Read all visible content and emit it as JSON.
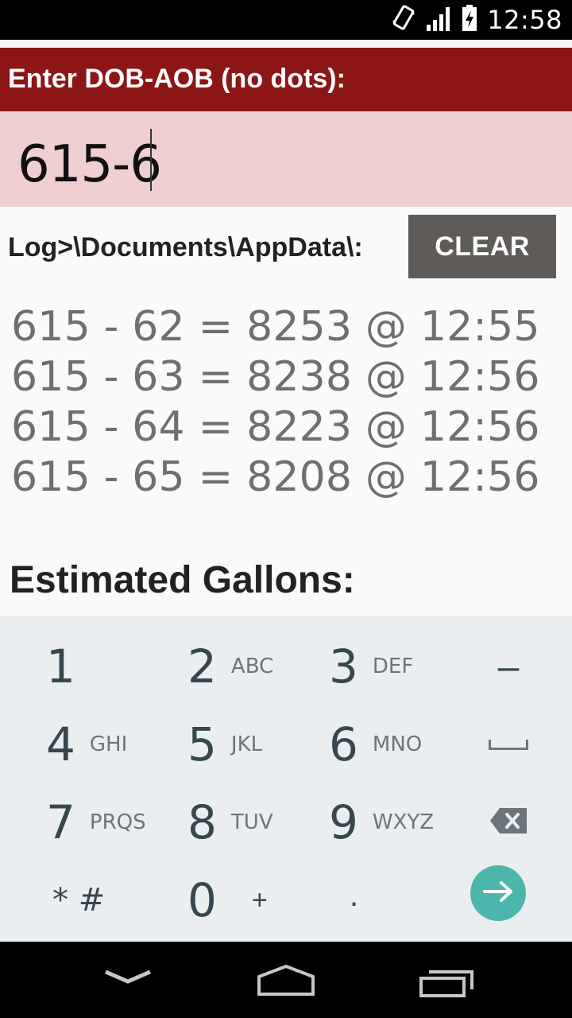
{
  "status_bar": {
    "time": "12:58",
    "icons": [
      "vibrate-icon",
      "signal-icon",
      "battery-charging-icon"
    ]
  },
  "header": {
    "title": "Enter DOB-AOB (no dots):"
  },
  "input": {
    "value": "615-6"
  },
  "log": {
    "label": "Log>\\Documents\\AppData\\:",
    "clear_button": "CLEAR",
    "entries": [
      "615 - 62 = 8253 @ 12:55",
      "615 - 63 = 8238 @ 12:56",
      "615 - 64 = 8223 @ 12:56",
      "615 - 65 = 8208 @ 12:56"
    ]
  },
  "estimate": {
    "label": "Estimated Gallons:"
  },
  "keyboard": {
    "keys": [
      {
        "num": "1",
        "sub": ""
      },
      {
        "num": "2",
        "sub": "ABC"
      },
      {
        "num": "3",
        "sub": "DEF"
      },
      {
        "num": "4",
        "sub": "GHI"
      },
      {
        "num": "5",
        "sub": "JKL"
      },
      {
        "num": "6",
        "sub": "MNO"
      },
      {
        "num": "7",
        "sub": "PRQS"
      },
      {
        "num": "8",
        "sub": "TUV"
      },
      {
        "num": "9",
        "sub": "WXYZ"
      },
      {
        "num": "0",
        "sub": "+"
      }
    ],
    "dash": "–",
    "star_hash": "* #",
    "dot": "."
  },
  "colors": {
    "header_bg": "#8c1515",
    "input_bg": "#efcfd0",
    "clear_bg": "#5f5b58",
    "go_button": "#4db6ac"
  }
}
